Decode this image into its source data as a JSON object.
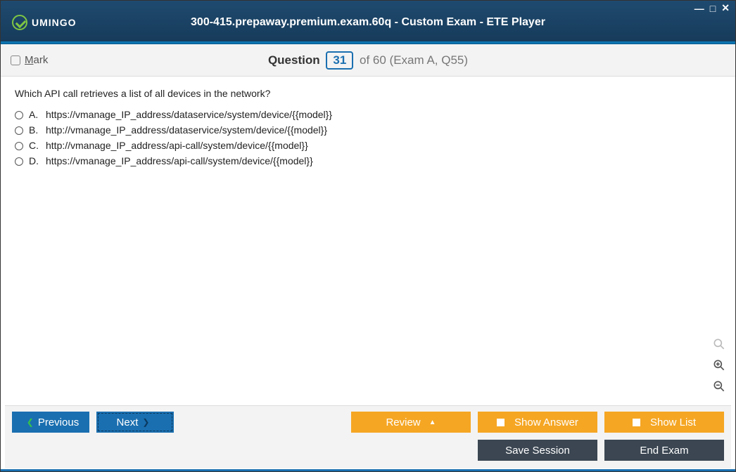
{
  "window": {
    "title": "300-415.prepaway.premium.exam.60q - Custom Exam - ETE Player",
    "logo_text": "UMINGO"
  },
  "subbar": {
    "mark_label": "Mark",
    "question_word": "Question",
    "question_number": "31",
    "of_text": "of 60 (Exam A, Q55)"
  },
  "question": {
    "text": "Which API call retrieves a list of all devices in the network?",
    "options": [
      {
        "letter": "A.",
        "text": "https://vmanage_IP_address/dataservice/system/device/{{model}}"
      },
      {
        "letter": "B.",
        "text": "http://vmanage_IP_address/dataservice/system/device/{{model}}"
      },
      {
        "letter": "C.",
        "text": "http://vmanage_IP_address/api-call/system/device/{{model}}"
      },
      {
        "letter": "D.",
        "text": "https://vmanage_IP_address/api-call/system/device/{{model}}"
      }
    ]
  },
  "footer": {
    "previous": "Previous",
    "next": "Next",
    "review": "Review",
    "show_answer": "Show Answer",
    "show_list": "Show List",
    "save_session": "Save Session",
    "end_exam": "End Exam"
  }
}
